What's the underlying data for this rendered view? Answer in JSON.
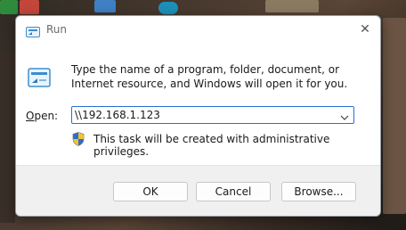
{
  "window": {
    "title": "Run",
    "close_symbol": "✕"
  },
  "body": {
    "description": "Type the name of a program, folder, document, or Internet resource, and Windows will open it for you.",
    "open_label_prefix": "",
    "open_label_mnemonic": "O",
    "open_label_suffix": "pen:",
    "command_value": "\\\\192.168.1.123",
    "admin_note": "This task will be created with administrative privileges."
  },
  "buttons": {
    "ok": "OK",
    "cancel": "Cancel",
    "browse": "Browse..."
  },
  "icons": {
    "title": "run-icon",
    "big": "run-icon",
    "shield": "uac-shield-icon",
    "dropdown": "chevron-down-icon",
    "close": "close-icon"
  },
  "colors": {
    "focus_border": "#2a6fcf",
    "footer_bg": "#f0f0f0"
  }
}
